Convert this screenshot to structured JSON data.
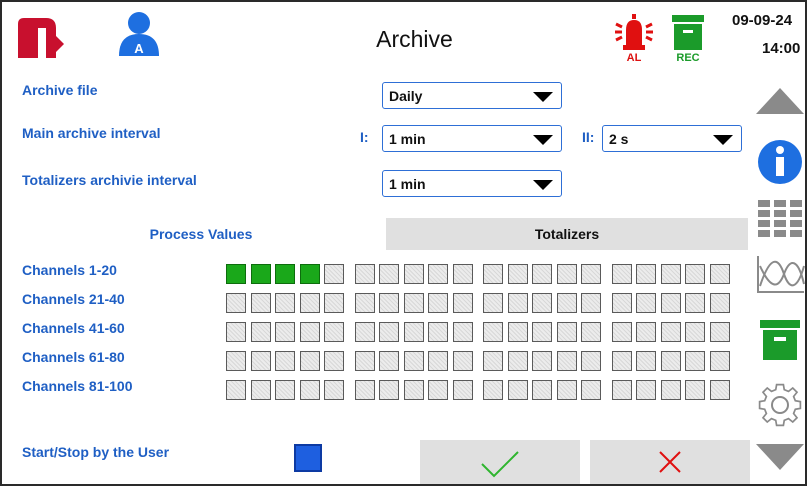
{
  "header": {
    "title": "Archive",
    "date": "09-09-24",
    "time": "14:00",
    "user_badge": "A",
    "alarm_label": "AL",
    "rec_label": "REC",
    "icons": [
      "logo-m",
      "user-icon",
      "alarm-icon",
      "rec-icon"
    ]
  },
  "settings": {
    "archive_file_label": "Archive file",
    "archive_file_value": "Daily",
    "main_interval_label": "Main archive interval",
    "interval_i_label": "I:",
    "interval_i_value": "1 min",
    "interval_ii_label": "II:",
    "interval_ii_value": "2 s",
    "totalizers_interval_label": "Totalizers archivie interval",
    "totalizers_interval_value": "1 min"
  },
  "tabs": {
    "process_values": "Process Values",
    "totalizers": "Totalizers",
    "active": "process_values"
  },
  "channels": {
    "rows": [
      {
        "label": "Channels 1-20",
        "enabled": [
          true,
          true,
          true,
          true,
          false,
          false,
          false,
          false,
          false,
          false,
          false,
          false,
          false,
          false,
          false,
          false,
          false,
          false,
          false,
          false
        ]
      },
      {
        "label": "Channels 21-40",
        "enabled": [
          false,
          false,
          false,
          false,
          false,
          false,
          false,
          false,
          false,
          false,
          false,
          false,
          false,
          false,
          false,
          false,
          false,
          false,
          false,
          false
        ]
      },
      {
        "label": "Channels 41-60",
        "enabled": [
          false,
          false,
          false,
          false,
          false,
          false,
          false,
          false,
          false,
          false,
          false,
          false,
          false,
          false,
          false,
          false,
          false,
          false,
          false,
          false
        ]
      },
      {
        "label": "Channels 61-80",
        "enabled": [
          false,
          false,
          false,
          false,
          false,
          false,
          false,
          false,
          false,
          false,
          false,
          false,
          false,
          false,
          false,
          false,
          false,
          false,
          false,
          false
        ]
      },
      {
        "label": "Channels 81-100",
        "enabled": [
          false,
          false,
          false,
          false,
          false,
          false,
          false,
          false,
          false,
          false,
          false,
          false,
          false,
          false,
          false,
          false,
          false,
          false,
          false,
          false
        ]
      }
    ]
  },
  "footer": {
    "start_stop_label": "Start/Stop by the User",
    "start_stop_checked": true,
    "ok_icon": "checkmark-icon",
    "cancel_icon": "cross-icon"
  },
  "rail": {
    "icons": [
      "scroll-up-icon",
      "info-icon",
      "table-icon",
      "chart-icon",
      "archive-icon",
      "settings-gear-icon",
      "scroll-down-icon"
    ]
  },
  "colors": {
    "accent_blue": "#1f5fc4",
    "logo_red": "#c8102e",
    "alarm_red": "#e01010",
    "rec_green": "#1b9b2a",
    "channel_on": "#1aa81a",
    "info_blue": "#1e6fe0"
  }
}
